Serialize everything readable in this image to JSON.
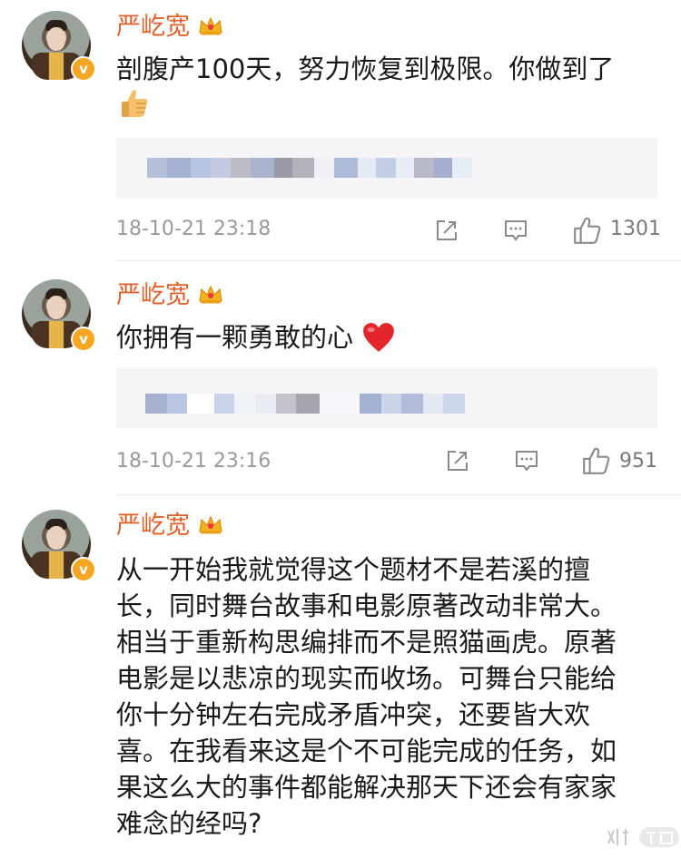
{
  "comments": [
    {
      "author": "严屹宽",
      "text": "剖腹产100天，努力恢复到极限。你做到了",
      "emoji": "thumbs-up",
      "timestamp": "18-10-21 23:18",
      "likes": "1301"
    },
    {
      "author": "严屹宽",
      "text": "你拥有一颗勇敢的心",
      "emoji": "red-heart",
      "timestamp": "18-10-21 23:16",
      "likes": "951"
    },
    {
      "author": "严屹宽",
      "lines": [
        "从一开始我就觉得这个题材不是若溪的擅",
        "长，同时舞台故事和电影原著改动非常大。",
        "相当于重新构思编排而不是照猫画虎。原著",
        "电影是以悲凉的现实而收场。可舞台只能给",
        "你十分钟左右完成矛盾冲突，还要皆大欢",
        "喜。在我看来这是个不可能完成的任务，如",
        "果这么大的事件都能解决那天下还会有家家",
        "难念的经吗?"
      ]
    }
  ],
  "badge_letter": "v",
  "colors": {
    "username": "#e0602a",
    "badge": "#f5a623",
    "meta": "#9a9a9a",
    "quote_bg": "#f5f5f7"
  },
  "icons": [
    "share-icon",
    "comment-icon",
    "like-icon",
    "crown-icon",
    "verified-badge-icon"
  ],
  "watermark_icon": "watermark-logo"
}
